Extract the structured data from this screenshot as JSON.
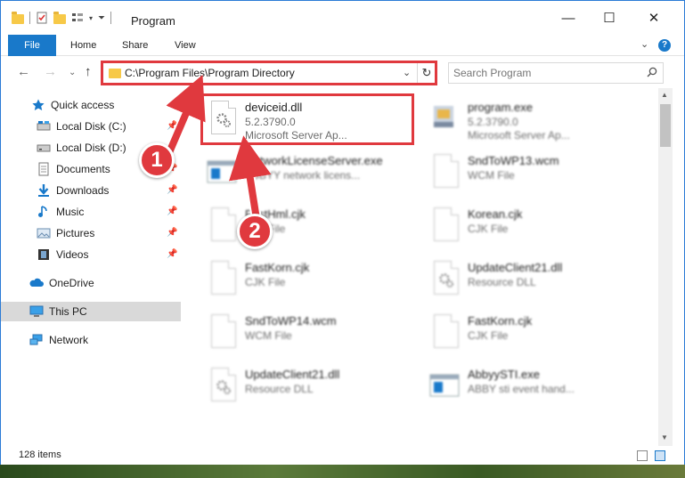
{
  "window": {
    "title": "Program",
    "controls": {
      "minimize": "—",
      "maximize": "☐",
      "close": "✕"
    }
  },
  "ribbon": {
    "tabs": [
      {
        "label": "File"
      },
      {
        "label": "Home"
      },
      {
        "label": "Share"
      },
      {
        "label": "View"
      }
    ],
    "help": "?"
  },
  "address": {
    "path": "C:\\Program Files\\Program Directory",
    "search_placeholder": "Search Program"
  },
  "sidebar": {
    "items": [
      {
        "label": "Quick access",
        "icon": "star-icon"
      },
      {
        "label": "Local Disk (C:)",
        "icon": "drive-icon"
      },
      {
        "label": "Local Disk (D:)",
        "icon": "drive-icon"
      },
      {
        "label": "Documents",
        "icon": "documents-icon"
      },
      {
        "label": "Downloads",
        "icon": "download-icon"
      },
      {
        "label": "Music",
        "icon": "music-icon"
      },
      {
        "label": "Pictures",
        "icon": "pictures-icon"
      },
      {
        "label": "Videos",
        "icon": "videos-icon"
      },
      {
        "label": "OneDrive",
        "icon": "cloud-icon"
      },
      {
        "label": "This PC",
        "icon": "computer-icon"
      },
      {
        "label": "Network",
        "icon": "network-icon"
      }
    ]
  },
  "files": [
    {
      "name": "deviceid.dll",
      "line1": "5.2.3790.0",
      "line2": "Microsoft Server Ap...",
      "icon": "dll-gear-icon"
    },
    {
      "name": "program.exe",
      "line1": "5.2.3790.0",
      "line2": "Microsoft Server Ap...",
      "icon": "exe-icon"
    },
    {
      "name": "NetworkLicenseServer.exe",
      "line1": "ABBYY network licens...",
      "line2": "",
      "icon": "exe-window-icon"
    },
    {
      "name": "SndToWP13.wcm",
      "line1": "WCM File",
      "line2": "",
      "icon": "file-icon"
    },
    {
      "name": "FastHml.cjk",
      "line1": "CJK File",
      "line2": "",
      "icon": "file-icon"
    },
    {
      "name": "Korean.cjk",
      "line1": "CJK File",
      "line2": "",
      "icon": "file-icon"
    },
    {
      "name": "FastKorn.cjk",
      "line1": "CJK File",
      "line2": "",
      "icon": "file-icon"
    },
    {
      "name": "UpdateClient21.dll",
      "line1": "Resource DLL",
      "line2": "",
      "icon": "dll-gear-icon"
    },
    {
      "name": "SndToWP14.wcm",
      "line1": "WCM File",
      "line2": "",
      "icon": "file-icon"
    },
    {
      "name": "FastKorn.cjk",
      "line1": "CJK File",
      "line2": "",
      "icon": "file-icon"
    },
    {
      "name": "UpdateClient21.dll",
      "line1": "Resource DLL",
      "line2": "",
      "icon": "dll-gear-icon"
    },
    {
      "name": "AbbyySTI.exe",
      "line1": "ABBY sti event hand...",
      "line2": "",
      "icon": "exe-window-icon"
    }
  ],
  "status": {
    "count": "128 items"
  },
  "annotations": {
    "step1": "1",
    "step2": "2"
  },
  "colors": {
    "accent": "#1979ca",
    "highlight": "#e0393e"
  }
}
